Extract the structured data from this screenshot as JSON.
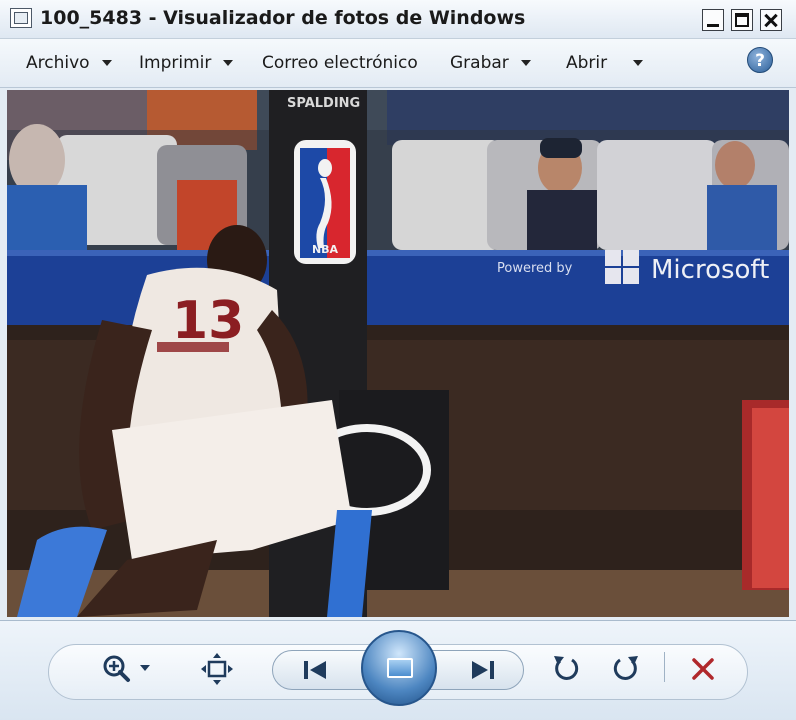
{
  "window": {
    "title": "100_5483 - Visualizador de fotos de Windows"
  },
  "menu": {
    "items": [
      {
        "label": "Archivo",
        "has_arrow": true
      },
      {
        "label": "Imprimir",
        "has_arrow": true
      },
      {
        "label": "Correo electrónico",
        "has_arrow": false
      },
      {
        "label": "Grabar",
        "has_arrow": true
      },
      {
        "label": "Abrir",
        "has_arrow": true
      }
    ],
    "help_glyph": "?"
  },
  "photo": {
    "backboard_brand": "SPALDING",
    "sponsor_text": "Powered by",
    "sponsor_brand": "Microsoft",
    "jersey_number": "13",
    "league_logo_text": "NBA"
  },
  "toolbar": {
    "icons": [
      "zoom-icon",
      "fit-to-window-icon",
      "previous-icon",
      "slideshow-icon",
      "next-icon",
      "rotate-counterclockwise-icon",
      "rotate-clockwise-icon",
      "delete-icon"
    ]
  },
  "colors": {
    "accent": "#2b5f99",
    "delete": "#b0282c"
  }
}
